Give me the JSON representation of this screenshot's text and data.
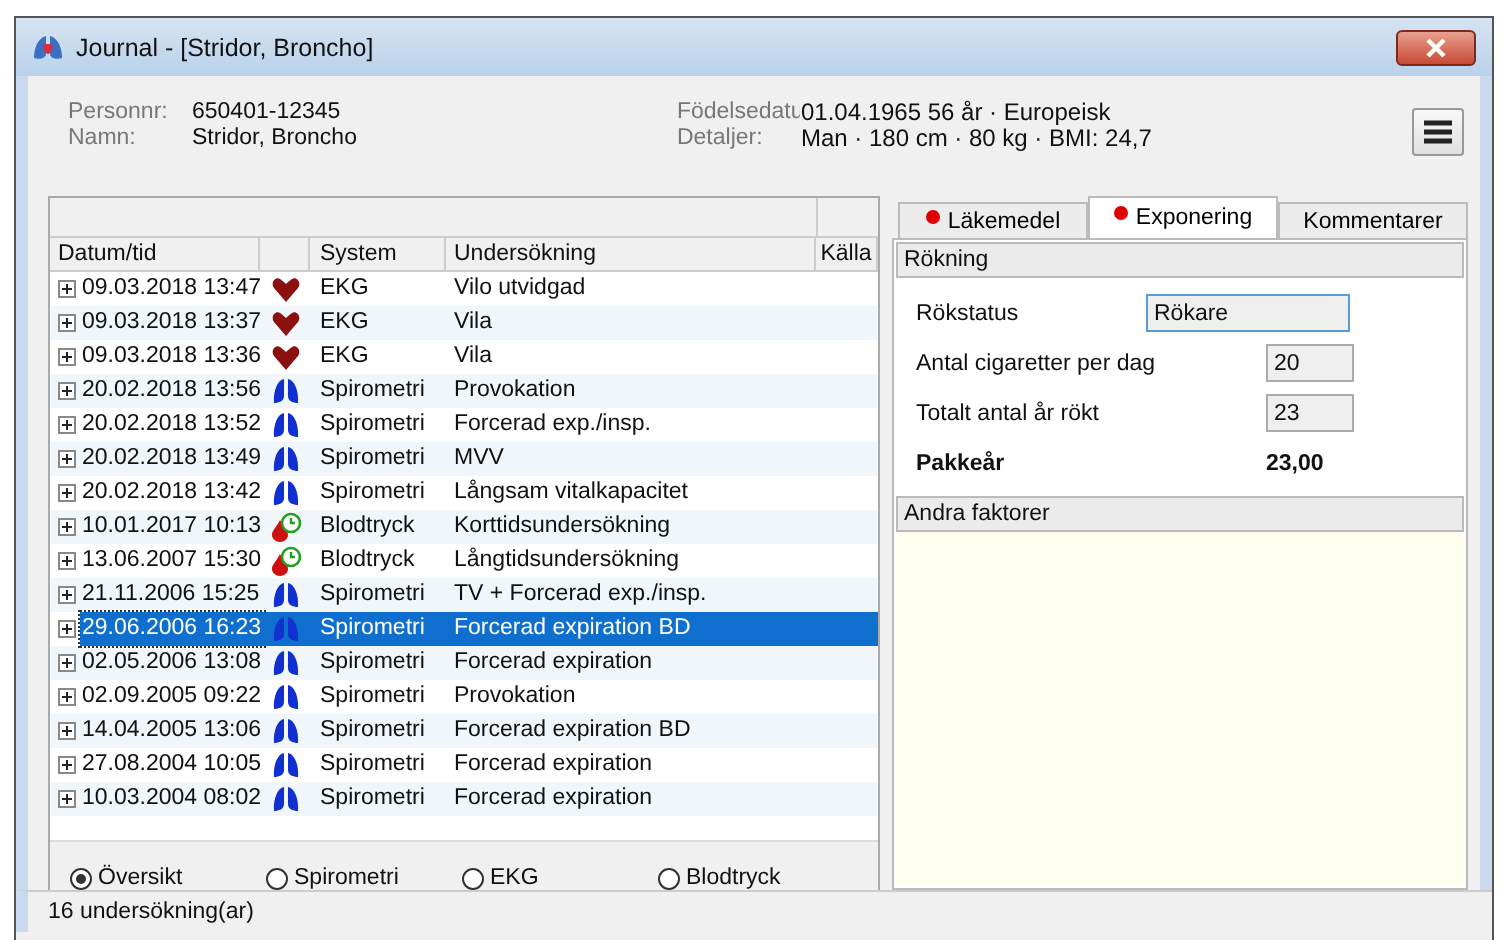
{
  "window": {
    "title": "Journal - [Stridor, Broncho]"
  },
  "patient": {
    "fields": [
      {
        "label": "Personnr:",
        "value": "650401-12345"
      },
      {
        "label": "Namn:",
        "value": "Stridor, Broncho"
      }
    ],
    "details": [
      {
        "label": "Födelsedatu",
        "value": "01.04.1965  56 år  ·  Europeisk"
      },
      {
        "label": "Detaljer:",
        "value": "Man  ·  180 cm  ·  80 kg  ·  BMI: 24,7"
      }
    ]
  },
  "table": {
    "columns": [
      "Datum/tid",
      "System",
      "Undersökning",
      "Källa"
    ],
    "rows": [
      {
        "date": "09.03.2018 13:47",
        "kind": "heart",
        "system": "EKG",
        "exam": "Vilo utvidgad",
        "selected": false
      },
      {
        "date": "09.03.2018 13:37",
        "kind": "heart",
        "system": "EKG",
        "exam": "Vila",
        "selected": false
      },
      {
        "date": "09.03.2018 13:36",
        "kind": "heart",
        "system": "EKG",
        "exam": "Vila",
        "selected": false
      },
      {
        "date": "20.02.2018 13:56",
        "kind": "lungs",
        "system": "Spirometri",
        "exam": "Provokation",
        "selected": false
      },
      {
        "date": "20.02.2018 13:52",
        "kind": "lungs",
        "system": "Spirometri",
        "exam": "Forcerad exp./insp.",
        "selected": false
      },
      {
        "date": "20.02.2018 13:49",
        "kind": "lungs",
        "system": "Spirometri",
        "exam": "MVV",
        "selected": false
      },
      {
        "date": "20.02.2018 13:42",
        "kind": "lungs",
        "system": "Spirometri",
        "exam": "Långsam vitalkapacitet",
        "selected": false
      },
      {
        "date": "10.01.2017 10:13",
        "kind": "pressure",
        "system": "Blodtryck",
        "exam": "Korttidsundersökning",
        "selected": false
      },
      {
        "date": "13.06.2007 15:30",
        "kind": "pressure",
        "system": "Blodtryck",
        "exam": "Långtidsundersökning",
        "selected": false
      },
      {
        "date": "21.11.2006 15:25",
        "kind": "lungs",
        "system": "Spirometri",
        "exam": "TV + Forcerad exp./insp.",
        "selected": false
      },
      {
        "date": "29.06.2006 16:23",
        "kind": "lungs",
        "system": "Spirometri",
        "exam": "Forcerad expiration BD",
        "selected": true
      },
      {
        "date": "02.05.2006 13:08",
        "kind": "lungs",
        "system": "Spirometri",
        "exam": "Forcerad expiration",
        "selected": false
      },
      {
        "date": "02.09.2005 09:22",
        "kind": "lungs",
        "system": "Spirometri",
        "exam": "Provokation",
        "selected": false
      },
      {
        "date": "14.04.2005 13:06",
        "kind": "lungs",
        "system": "Spirometri",
        "exam": "Forcerad expiration BD",
        "selected": false
      },
      {
        "date": "27.08.2004 10:05",
        "kind": "lungs",
        "system": "Spirometri",
        "exam": "Forcerad expiration",
        "selected": false
      },
      {
        "date": "10.03.2004 08:02",
        "kind": "lungs",
        "system": "Spirometri",
        "exam": "Forcerad expiration",
        "selected": false
      }
    ]
  },
  "filters": [
    {
      "label": "Översikt",
      "selected": true
    },
    {
      "label": "Spirometri",
      "selected": false
    },
    {
      "label": "EKG",
      "selected": false
    },
    {
      "label": "Blodtryck",
      "selected": false
    }
  ],
  "tabs": [
    {
      "label": "Läkemedel",
      "selected": false,
      "marked": true
    },
    {
      "label": "Exponering",
      "selected": true,
      "marked": true
    },
    {
      "label": "Kommentarer",
      "selected": false,
      "marked": false
    }
  ],
  "smoking": {
    "title": "Rökning",
    "status_label": "Rökstatus",
    "status_value": "Rökare",
    "fields": [
      {
        "label": "Antal cigaretter per dag",
        "value": "20"
      },
      {
        "label": "Totalt antal år rökt",
        "value": "23"
      }
    ],
    "pack_label": "Pakkeår",
    "pack_value": "23,00"
  },
  "other": {
    "title": "Andra faktorer"
  },
  "status_bar": "16 undersökning(ar)"
}
